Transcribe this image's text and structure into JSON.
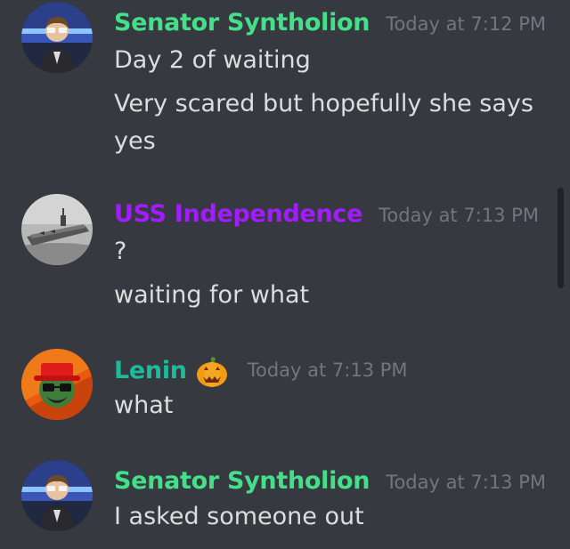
{
  "messages": [
    {
      "author": "Senator Syntholion",
      "author_color": "#43e089",
      "timestamp": "Today at 7:12 PM",
      "lines": [
        "Day 2 of waiting",
        "Very scared but hopefully she says",
        "yes"
      ]
    },
    {
      "author": "USS Independence",
      "author_color": "#a21cff",
      "timestamp": "Today at 7:13 PM",
      "lines": [
        "?",
        "waiting for what"
      ]
    },
    {
      "author": "Lenin",
      "author_color": "#1abc9c",
      "timestamp": "Today at 7:13 PM",
      "badge_icon": "jack-o-lantern-icon",
      "lines": [
        "what"
      ]
    },
    {
      "author": "Senator Syntholion",
      "author_color": "#43e089",
      "timestamp": "Today at 7:13 PM",
      "lines": [
        "I asked someone out"
      ]
    }
  ],
  "colors": {
    "background": "#36393f",
    "text": "#dcddde",
    "timestamp": "#72767d"
  }
}
